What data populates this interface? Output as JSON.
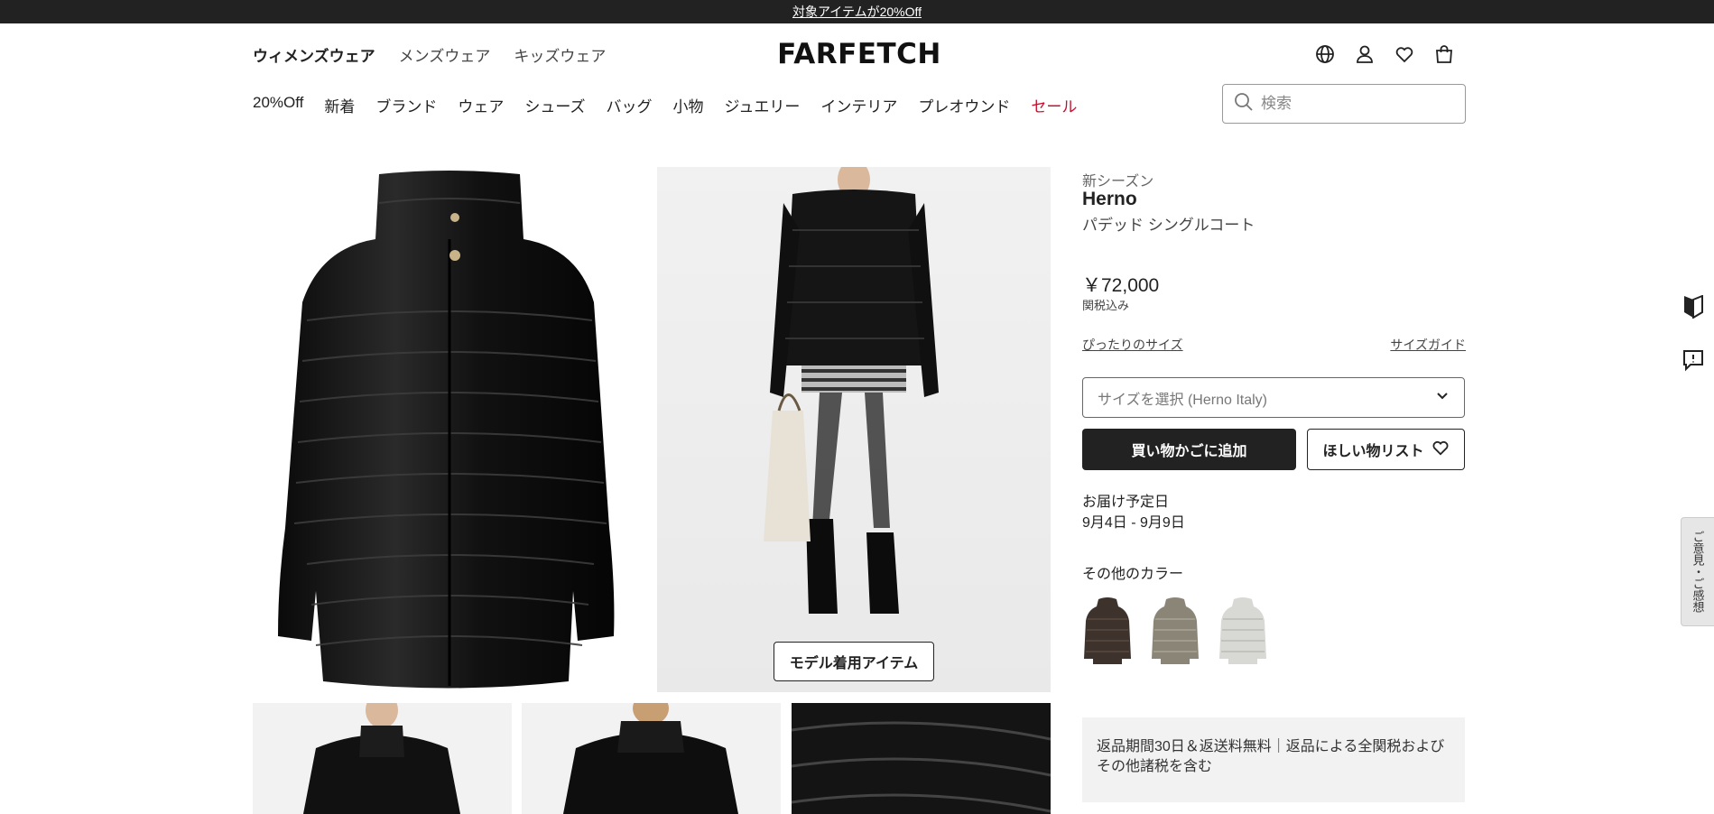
{
  "promo_banner": {
    "text": "対象アイテムが20%Off"
  },
  "gender_nav": [
    "ウィメンズウェア",
    "メンズウェア",
    "キッズウェア"
  ],
  "logo": "FARFETCH",
  "header_icons": [
    "globe-icon",
    "account-icon",
    "heart-icon",
    "bag-icon"
  ],
  "category_nav": [
    {
      "label": "20%Off"
    },
    {
      "label": "新着"
    },
    {
      "label": "ブランド"
    },
    {
      "label": "ウェア"
    },
    {
      "label": "シューズ"
    },
    {
      "label": "バッグ"
    },
    {
      "label": "小物"
    },
    {
      "label": "ジュエリー"
    },
    {
      "label": "インテリア"
    },
    {
      "label": "プレオウンド"
    },
    {
      "label": "セール"
    }
  ],
  "search": {
    "placeholder": "検索",
    "value": ""
  },
  "gallery": {
    "model_button_label": "モデル着用アイテム"
  },
  "product": {
    "season": "新シーズン",
    "brand": "Herno",
    "name": "パデッド シングルコート",
    "price": "￥72,000",
    "tax_note": "関税込み",
    "fit_link": "ぴったりのサイズ",
    "size_guide_link": "サイズガイド",
    "size_select_placeholder": "サイズを選択 (Herno Italy)",
    "add_to_bag_label": "買い物かごに追加",
    "wishlist_label": "ほしい物リスト",
    "delivery_label": "お届け予定日",
    "delivery_date": "9月4日 - 9月9日",
    "other_colors_label": "その他のカラー",
    "other_colors": [
      "#3d322c",
      "#8a8577",
      "#d8d8d4"
    ],
    "returns_text": "返品期間30日＆返送料無料｜返品による全関税およびその他諸税を含む"
  },
  "side_widgets": {
    "feedback_label": "ご意見・ご感想"
  },
  "colors": {
    "promo_bg": "#222222",
    "sale": "#c8102e",
    "primary_button": "#222222"
  }
}
